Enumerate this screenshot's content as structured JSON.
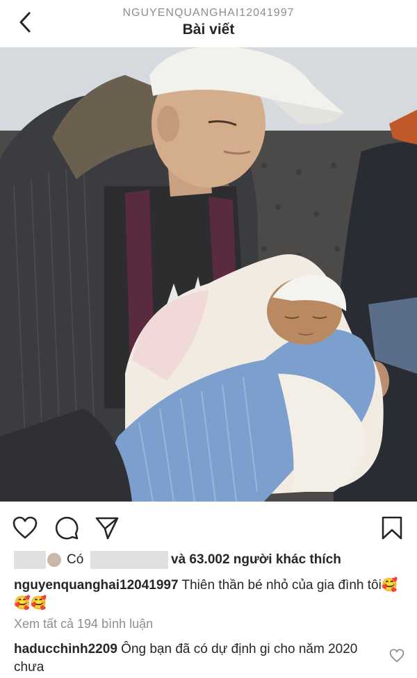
{
  "header": {
    "username": "NGUYENQUANGHAI12041997",
    "title": "Bài viết"
  },
  "post": {
    "image_alt": "Man in white cap and hoodie holding a newborn baby wrapped in a blue and white blanket"
  },
  "likes": {
    "prefix": "Có",
    "suffix": "và 63.002 người khác thích"
  },
  "caption": {
    "username": "nguyenquanghai12041997",
    "text": " Thiên thần bé nhỏ của gia đình tôi🥰🥰🥰"
  },
  "view_comments": "Xem tất cả 194 bình luận",
  "comment": {
    "username": "haducchinh2209",
    "text": " Ông bạn đã có dự định gi cho năm 2020 chưa"
  },
  "icons": [
    "back-icon",
    "heart-icon",
    "comment-icon",
    "share-icon",
    "bookmark-icon",
    "small-heart-icon"
  ]
}
